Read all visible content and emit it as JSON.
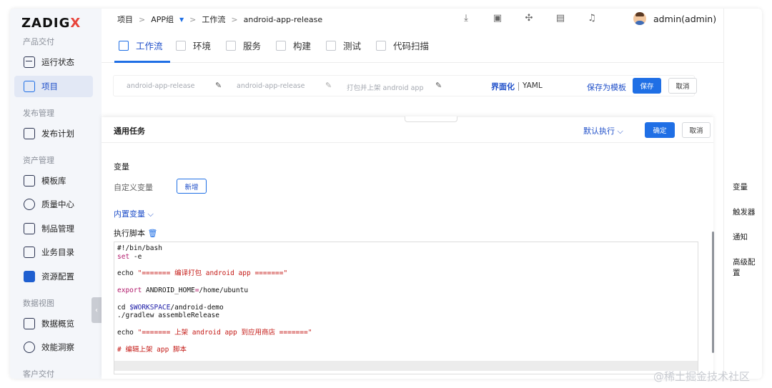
{
  "app": {
    "logo": "ZADIG",
    "logo_accent": "X"
  },
  "sidebar": {
    "sections": [
      {
        "title": "产品交付",
        "items": [
          {
            "label": "运行状态",
            "icon": "pulse-icon"
          },
          {
            "label": "项目",
            "icon": "project-icon",
            "active": true
          }
        ]
      },
      {
        "title": "发布管理",
        "items": [
          {
            "label": "发布计划",
            "icon": "plan-icon"
          }
        ]
      },
      {
        "title": "资产管理",
        "items": [
          {
            "label": "模板库",
            "icon": "template-icon"
          },
          {
            "label": "质量中心",
            "icon": "flask-icon"
          },
          {
            "label": "制品管理",
            "icon": "package-icon"
          },
          {
            "label": "业务目录",
            "icon": "catalog-icon"
          },
          {
            "label": "资源配置",
            "icon": "gear-icon"
          }
        ]
      },
      {
        "title": "数据视图",
        "items": [
          {
            "label": "数据概览",
            "icon": "chart-icon"
          },
          {
            "label": "效能洞察",
            "icon": "pie-icon"
          }
        ]
      },
      {
        "title": "客户交付",
        "items": []
      }
    ],
    "collapse_glyph": "‹"
  },
  "breadcrumb": {
    "root": "项目",
    "group": "APP组",
    "section": "工作流",
    "current": "android-app-release"
  },
  "user": {
    "name": "admin(admin)"
  },
  "tabs": [
    {
      "label": "工作流",
      "active": true
    },
    {
      "label": "环境"
    },
    {
      "label": "服务"
    },
    {
      "label": "构建"
    },
    {
      "label": "测试"
    },
    {
      "label": "代码扫描"
    }
  ],
  "workflow": {
    "name_placeholder": "android-app-release",
    "key_placeholder": "android-app-release",
    "desc_placeholder": "打包并上架 android app",
    "mode_ui": "界面化",
    "mode_yaml": "YAML",
    "save_template": "保存为模板",
    "save": "保存",
    "cancel": "取消"
  },
  "drawer": {
    "title": "通用任务",
    "run_mode": "默认执行",
    "confirm": "确定",
    "cancel": "取消",
    "variables_title": "变量",
    "custom_vars": "自定义变量",
    "add": "新增",
    "builtin_vars": "内置变量",
    "script_title": "执行脚本"
  },
  "script_lines": [
    "#!/bin/bash",
    "set -e",
    "",
    "echo \"======= 编译打包 android app =======\"",
    "",
    "export ANDROID_HOME=/home/ubuntu",
    "",
    "cd $WORKSPACE/android-demo",
    "./gradlew assembleRelease",
    "",
    "echo \"======= 上架 android app 到应用商店 =======\"",
    "",
    "# 编辑上架 app 脚本"
  ],
  "anchors": [
    "变量",
    "触发器",
    "通知",
    "高级配置"
  ],
  "watermark": "@稀土掘金技术社区",
  "colors": {
    "accent": "#1f6fe5",
    "logo_accent": "#e8453c"
  }
}
